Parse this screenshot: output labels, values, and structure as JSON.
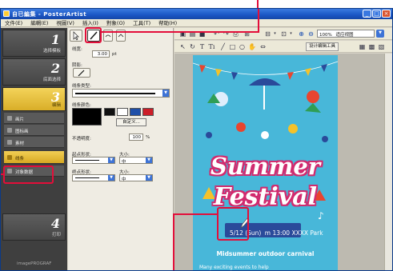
{
  "window": {
    "title": "PosterArtist",
    "title_jp": "自已編集"
  },
  "menubar": {
    "items": [
      "文件(E)",
      "編輯(E)",
      "視圖(V)",
      "插入(I)",
      "對象(O)",
      "工具(T)",
      "帮助(H)"
    ]
  },
  "steps": [
    {
      "num": "1",
      "label": "选择模板"
    },
    {
      "num": "2",
      "label": "底面选择"
    },
    {
      "num": "3",
      "label": "编辑"
    },
    {
      "num": "4",
      "label": "打印"
    }
  ],
  "step3_subitems": [
    "画片",
    "图标画",
    "素材",
    "线条",
    "对象数据"
  ],
  "bottom_label": "imagePROGRAF",
  "props": {
    "width_label": "线宽:",
    "width_value": "3.00",
    "width_unit": "pt",
    "shadow_label": "阴影:",
    "linetype_label": "线条类型:",
    "linecolor_label": "线条颜色:",
    "custom_button": "自定义...",
    "opacity_label": "不透明度:",
    "opacity_value": "100",
    "opacity_unit": "%",
    "start_shape_label": "起点形状:",
    "start_size_label": "大小:",
    "start_size_value": "中",
    "end_shape_label": "终点形状:",
    "end_size_label": "大小:",
    "end_size_value": "中"
  },
  "toolbar": {
    "zoom_value": "100%",
    "zoom_mode": "适应视图",
    "design_tools_button": "设计编辑工具"
  },
  "poster": {
    "title_line1": "Summer",
    "title_line2": "Festival",
    "date_pill": "5/12 (Sun)",
    "date_rest": "m 13:00  XXXX Park",
    "subtitle": "Midsummer outdoor carnival",
    "body": "Many exciting events to help"
  },
  "colors": {
    "accent_callout": "#e30e3a",
    "step_active": "#e6bd3a",
    "poster_bg": "#48b7d9",
    "title_text": "#ffffff",
    "title_outline": "#d22a6e"
  },
  "icons": {
    "line_tool": "diagonal-line-icon",
    "arrow_tool": "arrow-pointer-icon",
    "rotate_tool": "rotate-icon",
    "text_tool": "text-icon",
    "line_draw": "line-icon",
    "rect_tool": "rectangle-icon",
    "ellipse_tool": "ellipse-icon",
    "hand_tool": "hand-icon",
    "zoom_in": "zoom-in-icon",
    "zoom_out": "zoom-out-icon"
  }
}
